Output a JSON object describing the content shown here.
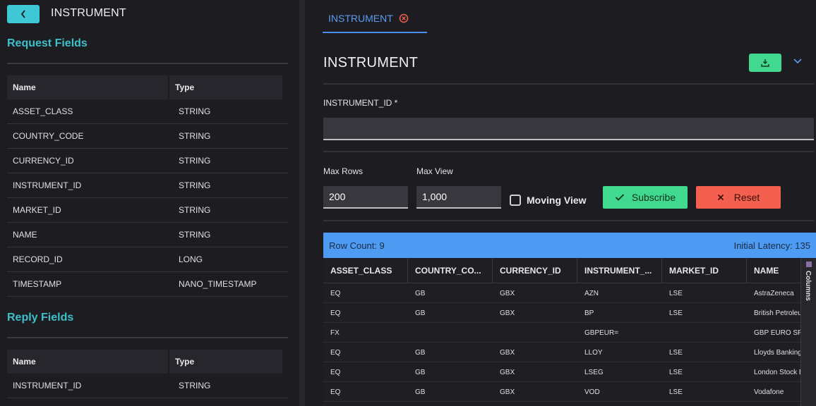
{
  "left": {
    "title": "INSTRUMENT",
    "request_title": "Request Fields",
    "request_headers": {
      "name": "Name",
      "type": "Type"
    },
    "request_fields": [
      {
        "name": "ASSET_CLASS",
        "type": "STRING"
      },
      {
        "name": "COUNTRY_CODE",
        "type": "STRING"
      },
      {
        "name": "CURRENCY_ID",
        "type": "STRING"
      },
      {
        "name": "INSTRUMENT_ID",
        "type": "STRING"
      },
      {
        "name": "MARKET_ID",
        "type": "STRING"
      },
      {
        "name": "NAME",
        "type": "STRING"
      },
      {
        "name": "RECORD_ID",
        "type": "LONG"
      },
      {
        "name": "TIMESTAMP",
        "type": "NANO_TIMESTAMP"
      }
    ],
    "reply_title": "Reply Fields",
    "reply_headers": {
      "name": "Name",
      "type": "Type"
    },
    "reply_fields": [
      {
        "name": "INSTRUMENT_ID",
        "type": "STRING"
      }
    ]
  },
  "tab": {
    "label": "INSTRUMENT"
  },
  "main": {
    "title": "INSTRUMENT",
    "instrument_id_label": "INSTRUMENT_ID *",
    "instrument_id_value": "",
    "max_rows_label": "Max Rows",
    "max_rows_value": "200",
    "max_view_label": "Max View",
    "max_view_value": "1,000",
    "moving_view_label": "Moving View",
    "subscribe_label": "Subscribe",
    "reset_label": "Reset"
  },
  "grid": {
    "row_count": "Row Count: 9",
    "latency": "Initial Latency: 135",
    "columns_label": "Columns",
    "headers": [
      "ASSET_CLASS",
      "COUNTRY_CO...",
      "CURRENCY_ID",
      "INSTRUMENT_...",
      "MARKET_ID",
      "NAME"
    ],
    "rows": [
      [
        "EQ",
        "GB",
        "GBX",
        "AZN",
        "LSE",
        "AstraZeneca"
      ],
      [
        "EQ",
        "GB",
        "GBX",
        "BP",
        "LSE",
        "British Petroleum"
      ],
      [
        "FX",
        "",
        "",
        "GBPEUR=",
        "",
        "GBP EURO SPOT"
      ],
      [
        "EQ",
        "GB",
        "GBX",
        "LLOY",
        "LSE",
        "Lloyds Banking"
      ],
      [
        "EQ",
        "GB",
        "GBX",
        "LSEG",
        "LSE",
        "London Stock Exchange"
      ],
      [
        "EQ",
        "GB",
        "GBX",
        "VOD",
        "LSE",
        "Vodafone"
      ]
    ]
  },
  "colors": {
    "accent_teal": "#3ec7d4",
    "accent_blue": "#4e9bf3",
    "green": "#40d98f",
    "red": "#f4604f"
  }
}
